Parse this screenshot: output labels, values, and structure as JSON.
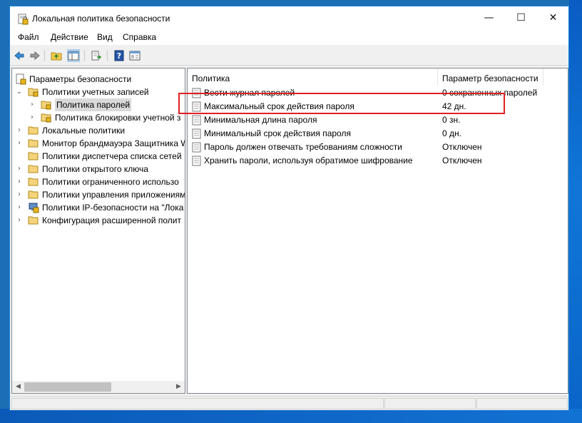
{
  "window": {
    "title": "Локальная политика безопасности",
    "minimize_glyph": "—",
    "maximize_glyph": "☐",
    "close_glyph": "✕"
  },
  "menu": [
    "Файл",
    "Действие",
    "Вид",
    "Справка"
  ],
  "toolbar": {
    "buttons": [
      "back-icon",
      "forward-icon",
      "up-folder-icon",
      "show-hide-tree-icon",
      "export-list-icon",
      "help-icon",
      "properties-icon"
    ],
    "pressed": "show-hide-tree-icon"
  },
  "tree": {
    "root": "Параметры безопасности",
    "items": [
      {
        "label": "Политики учетных записей",
        "expanded": true,
        "icon": "folder-open-icon"
      },
      {
        "label": "Политика паролей",
        "selected": true,
        "icon": "folder-lock-icon"
      },
      {
        "label": "Политика блокировки учетной з",
        "icon": "folder-lock-icon"
      },
      {
        "label": "Локальные политики",
        "icon": "folder-icon"
      },
      {
        "label": "Монитор брандмауэра Защитника W",
        "icon": "folder-icon"
      },
      {
        "label": "Политики диспетчера списка сетей",
        "icon": "folder-icon"
      },
      {
        "label": "Политики открытого ключа",
        "icon": "folder-icon"
      },
      {
        "label": "Политики ограниченного использо",
        "icon": "folder-icon"
      },
      {
        "label": "Политики управления приложениям",
        "icon": "folder-icon"
      },
      {
        "label": "Политики IP-безопасности на \"Лока",
        "icon": "ipsec-icon"
      },
      {
        "label": "Конфигурация расширенной полит",
        "icon": "folder-icon"
      }
    ]
  },
  "list": {
    "columns": [
      "Политика",
      "Параметр безопасности"
    ],
    "rows": [
      {
        "policy": "Вести журнал паролей",
        "value": "0 сохраненных паролей"
      },
      {
        "policy": "Максимальный срок действия пароля",
        "value": "42 дн."
      },
      {
        "policy": "Минимальная длина пароля",
        "value": "0 зн."
      },
      {
        "policy": "Минимальный срок действия пароля",
        "value": "0 дн."
      },
      {
        "policy": "Пароль должен отвечать требованиям сложности",
        "value": "Отключен"
      },
      {
        "policy": "Хранить пароли, используя обратимое шифрование",
        "value": "Отключен"
      }
    ],
    "highlighted_row": 1,
    "highlight_color": "#e02020"
  }
}
